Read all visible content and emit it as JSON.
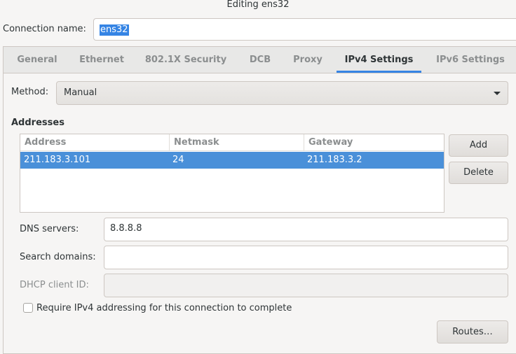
{
  "window": {
    "title": "Editing ens32"
  },
  "connection": {
    "label": "Connection name:",
    "value": "ens32"
  },
  "tabs": [
    {
      "label": "General"
    },
    {
      "label": "Ethernet"
    },
    {
      "label": "802.1X Security"
    },
    {
      "label": "DCB"
    },
    {
      "label": "Proxy"
    },
    {
      "label": "IPv4 Settings",
      "active": true
    },
    {
      "label": "IPv6 Settings"
    }
  ],
  "method": {
    "label": "Method:",
    "value": "Manual"
  },
  "addresses": {
    "section_label": "Addresses",
    "columns": [
      "Address",
      "Netmask",
      "Gateway"
    ],
    "rows": [
      {
        "address": "211.183.3.101",
        "netmask": "24",
        "gateway": "211.183.3.2"
      }
    ],
    "add_label": "Add",
    "delete_label": "Delete"
  },
  "dns": {
    "label": "DNS servers:",
    "value": "8.8.8.8"
  },
  "search_domains": {
    "label": "Search domains:",
    "value": ""
  },
  "dhcp_client_id": {
    "label": "DHCP client ID:",
    "value": ""
  },
  "require_ipv4": {
    "label": "Require IPv4 addressing for this connection to complete",
    "checked": false
  },
  "routes": {
    "label": "Routes…"
  },
  "colors": {
    "accent": "#3584e4",
    "selection": "#4a90d9"
  }
}
